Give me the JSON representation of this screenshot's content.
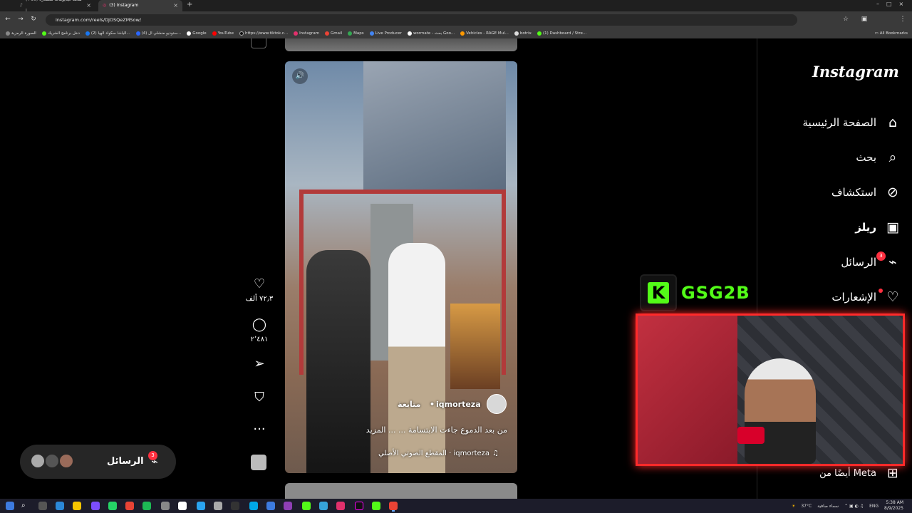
{
  "browser": {
    "tabs": [
      {
        "label": "(+99) شاهد فيديوهات متصدرة |"
      },
      {
        "label": "(3) Instagram"
      }
    ],
    "url": "instagram.com/reels/DJOSQeZMSow/",
    "bookmarks": [
      "الصورة الرمزية",
      "دخل برنامج الشريك",
      "(2) الياشا سكواد الهيا...",
      "(4) ستوديو منشلي ال...",
      "Google",
      "YouTube",
      "https://www.tiktok.c...",
      "Instagram",
      "Gmail",
      "Maps",
      "Live Producer",
      "wormate - بحث Goo...",
      "Vehicles - RAGE Mul...",
      "botrix",
      "(1) Dashboard / Stre..."
    ],
    "all_bookmarks": "All Bookmarks"
  },
  "reel": {
    "username": "iqmorteza",
    "follow_label": "متابعة",
    "caption": "من بعد الدموع جاءت الابتسامة ... ... المزيد",
    "audio": "iqmorteza · المقطع الصوتي الأصلي"
  },
  "actions": {
    "likes": "٧٢٫٣ ألف",
    "comments": "٢٬٤٨١"
  },
  "messages_pill": {
    "label": "الرسائل",
    "badge": "3"
  },
  "sidenav": {
    "logo": "Instagram",
    "items": [
      {
        "label": "الصفحة الرئيسية"
      },
      {
        "label": "بحث"
      },
      {
        "label": "استكشاف"
      },
      {
        "label": "ريلز"
      },
      {
        "label": "الرسائل",
        "badge": "3"
      },
      {
        "label": "الإشعارات"
      }
    ],
    "also_from": "أيضًا من Meta"
  },
  "stream_overlay": {
    "channel": "GSG2B",
    "kick_letter": "K"
  },
  "taskbar": {
    "weather": "37°C",
    "weather_desc": "سماء صافية",
    "lang": "ENG",
    "time": "5:38 AM",
    "date": "8/9/2025"
  },
  "colors": {
    "kick_green": "#53fc18",
    "badge_red": "#ff3040",
    "webcam_border": "#ff2a2a"
  }
}
